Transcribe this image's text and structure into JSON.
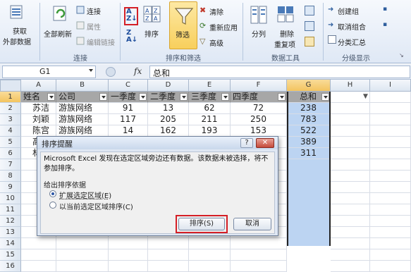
{
  "ribbon": {
    "get_external_line1": "获取",
    "get_external_line2": "外部数据",
    "refresh_all": "全部刷新",
    "connections": "连接",
    "properties": "属性",
    "edit_links": "编辑链接",
    "connections_group": "连接",
    "sort": "排序",
    "filter": "筛选",
    "clear": "清除",
    "reapply": "重新应用",
    "advanced": "高级",
    "sort_filter_group": "排序和筛选",
    "text_to_columns": "分列",
    "remove_dup_line1": "删除",
    "remove_dup_line2": "重复项",
    "data_tools_group": "数据工具",
    "group": "创建组",
    "ungroup": "取消组合",
    "subtotal": "分类汇总",
    "outline_group": "分级显示"
  },
  "formula_bar": {
    "name_box": "G1",
    "fx": "fx",
    "formula": "总和"
  },
  "columns": [
    "A",
    "B",
    "C",
    "D",
    "E",
    "F",
    "G",
    "H",
    "I"
  ],
  "rows": [
    "1",
    "2",
    "3",
    "4",
    "5",
    "6",
    "7",
    "8",
    "9",
    "10",
    "11",
    "12",
    "13",
    "14",
    "15",
    "16"
  ],
  "header_row": [
    "姓名",
    "公司",
    "一季度",
    "二季度",
    "三季度",
    "四季度",
    "总和"
  ],
  "data_rows": [
    [
      "苏洁",
      "游族网络",
      "91",
      "13",
      "62",
      "72",
      "238"
    ],
    [
      "刘颖",
      "游族网络",
      "117",
      "205",
      "211",
      "250",
      "783"
    ],
    [
      "陈宫",
      "游族网络",
      "14",
      "162",
      "193",
      "153",
      "522"
    ],
    [
      "高",
      "",
      "",
      "",
      "",
      "",
      "389"
    ],
    [
      "林",
      "",
      "",
      "",
      "",
      "",
      "311"
    ]
  ],
  "dialog": {
    "title": "排序提醒",
    "help": "?",
    "close": "✕",
    "message": "Microsoft Excel 发现在选定区域旁边还有数据。该数据未被选择，将不参加排序。",
    "group_title": "给出排序依据",
    "option_expand": "扩展选定区域(E)",
    "option_current": "以当前选定区域排序(C)",
    "sort_button": "排序(S)",
    "cancel_button": "取消"
  },
  "colors": {
    "selection": "#bcd4f2",
    "highlight_box": "#d41f26",
    "header_fill": "#a7a7a7"
  }
}
